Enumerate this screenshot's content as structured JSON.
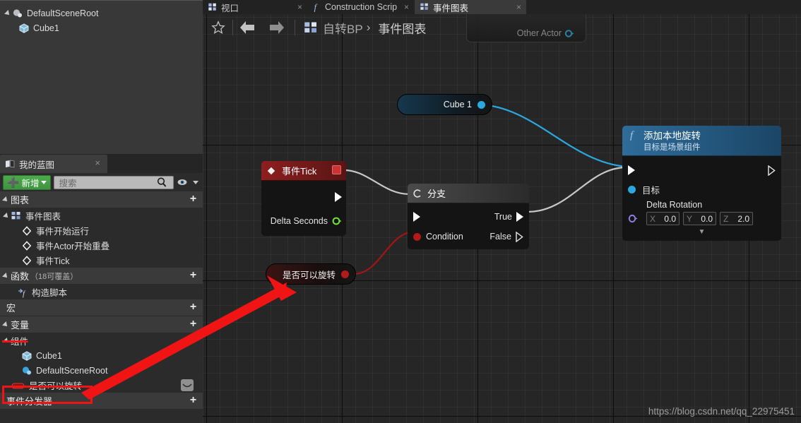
{
  "outliner": {
    "items": [
      {
        "label": "DefaultSceneRoot",
        "icon": "scene-root-icon",
        "indent": 0,
        "expanded": true
      },
      {
        "label": "Cube1",
        "icon": "cube-component-icon",
        "indent": 1,
        "expanded": false
      }
    ]
  },
  "my_blueprint": {
    "tab_label": "我的蓝图",
    "tab_icon": "blueprint-book-icon",
    "close_label": "×",
    "add_button": "新增",
    "search_placeholder": "搜索",
    "search_value": "",
    "sections": [
      {
        "title": "图表",
        "subtitle": "",
        "add_label": "+",
        "items": [
          {
            "label": "事件图表",
            "icon": "graph-icon",
            "level": 1,
            "expandable": true
          },
          {
            "label": "事件开始运行",
            "icon": "event-node-icon",
            "level": 2
          },
          {
            "label": "事件Actor开始重叠",
            "icon": "event-node-icon",
            "level": 2
          },
          {
            "label": "事件Tick",
            "icon": "event-node-icon",
            "level": 2
          }
        ]
      },
      {
        "title": "函数",
        "subtitle": "（18可覆盖）",
        "add_label": "+",
        "items": [
          {
            "label": "构造脚本",
            "icon": "function-icon",
            "level": 1
          }
        ]
      },
      {
        "title": "宏",
        "subtitle": "",
        "add_label": "+",
        "items": []
      },
      {
        "title": "变量",
        "subtitle": "",
        "add_label": "+",
        "items": [
          {
            "label": "组件",
            "icon": "",
            "level": 0,
            "group": true
          },
          {
            "label": "Cube1",
            "icon": "cube-component-icon",
            "level": 2
          },
          {
            "label": "DefaultSceneRoot",
            "icon": "scene-root-icon",
            "level": 2
          },
          {
            "label": "是否可以旋转",
            "icon": "bool-variable-icon",
            "level": 2,
            "highlighted": true,
            "eye_icon": "visibility-eye-icon"
          }
        ]
      },
      {
        "title": "事件分发器",
        "subtitle": "",
        "add_label": "+",
        "items": []
      }
    ]
  },
  "graph_tabs": [
    {
      "label": "视口",
      "icon": "viewport-icon",
      "active": false,
      "close": "×"
    },
    {
      "label": "Construction Scrip",
      "icon": "function-f-icon",
      "active": false,
      "close": "×"
    },
    {
      "label": "事件图表",
      "icon": "graph-icon",
      "active": true,
      "close": "×"
    }
  ],
  "breadcrumb": {
    "star_icon": "favorite-star-icon",
    "back_icon": "back-arrow-icon",
    "forward_icon": "forward-arrow-icon",
    "blueprint_icon": "graph-icon",
    "blueprint_name": "自转BP",
    "separator": "›",
    "graph_name": "事件图表"
  },
  "ghost_node": {
    "label": "Other Actor",
    "pin_icon": "object-pin-icon"
  },
  "nodes": {
    "event_tick": {
      "title": "事件Tick",
      "icon": "event-diamond-icon",
      "stop_icon": "stop-button-icon",
      "output_pin_label": "Delta Seconds",
      "exec_out_icon": "exec-pin-icon",
      "float_pin_icon": "float-pin-icon"
    },
    "branch": {
      "title": "分支",
      "icon": "branch-icon",
      "exec_in_icon": "exec-pin-icon",
      "condition_label": "Condition",
      "condition_pin_icon": "bool-pin-icon",
      "true_label": "True",
      "false_label": "False"
    },
    "add_local_rotation": {
      "title": "添加本地旋转",
      "subtitle": "目标是场景组件",
      "icon": "function-f-icon",
      "target_label": "目标",
      "target_pin_icon": "object-pin-icon",
      "delta_rotation_label": "Delta Rotation",
      "rotator_pin_icon": "rotator-pin-icon",
      "vector": [
        {
          "axis": "X",
          "value": "0.0"
        },
        {
          "axis": "Y",
          "value": "0.0"
        },
        {
          "axis": "Z",
          "value": "2.0"
        }
      ],
      "collapse_icon": "chevron-down-icon"
    },
    "cube_getter": {
      "label": "Cube 1",
      "pin_icon": "object-pin-icon"
    },
    "bool_getter": {
      "label": "是否可以旋转",
      "pin_icon": "bool-pin-icon"
    }
  },
  "watermark": "https://blog.csdn.net/qq_22975451",
  "colors": {
    "exec_wire": "#c8c8c8",
    "object_wire": "#2aa8e0",
    "bool_wire": "#a31515",
    "annotation_red": "#f01414",
    "add_button_green": "#4caa4c",
    "function_blue": "#2f6c9a",
    "event_red": "#8d1f1f"
  }
}
